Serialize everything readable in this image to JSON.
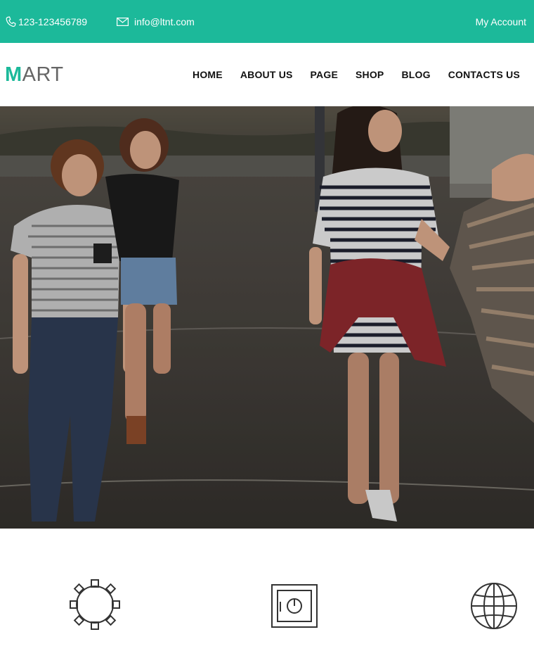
{
  "topbar": {
    "phone": "123-123456789",
    "email": "info@ltnt.com",
    "account": "My Account",
    "phone_icon": "phone-icon",
    "email_icon": "envelope-icon",
    "bg_color": "#1cb99a"
  },
  "header": {
    "logo_first": "M",
    "logo_rest": "ART",
    "brand_color": "#1cb99a"
  },
  "nav": {
    "items": [
      "HOME",
      "ABOUT US",
      "PAGE",
      "SHOP",
      "BLOG",
      "CONTACTS US"
    ]
  },
  "hero": {
    "image": "photo of young women walking outdoors"
  },
  "features": {
    "icons": [
      "gear-icon",
      "safe-icon",
      "globe-icon"
    ]
  }
}
